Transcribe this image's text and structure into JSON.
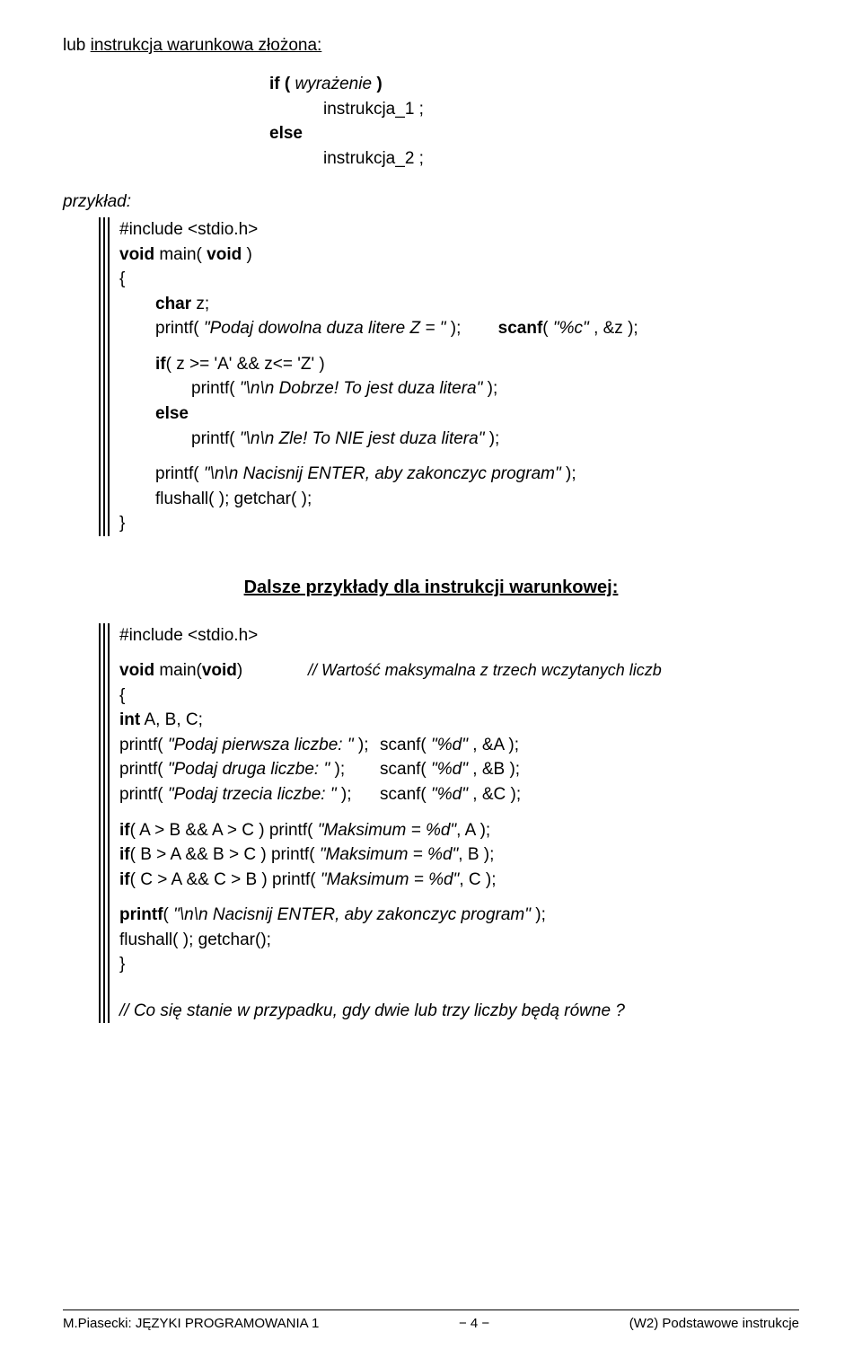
{
  "intro": {
    "prefix": "lub ",
    "underlined": "instrukcja warunkowa złożona:"
  },
  "syntax": {
    "line1a": "if ( ",
    "line1b": "wyrażenie",
    "line1c": " )",
    "line2": "instrukcja_1 ;",
    "line3": "else",
    "line4": "instrukcja_2 ;"
  },
  "example_label": "przykład:",
  "code1": {
    "l1": "#include <stdio.h>",
    "l2a": "void",
    "l2b": " main( ",
    "l2c": "void",
    "l2d": " )",
    "l3": "{",
    "l4a": "char",
    "l4b": " z;",
    "l5a": "printf( ",
    "l5b": "\"Podaj dowolna duza litere Z = \"",
    "l5c": " );",
    "l5d": "scanf",
    "l5e": "( ",
    "l5f": "\"%c\"",
    "l5g": " , &z );",
    "l6a": "if",
    "l6b": "( z >= 'A'  &&  z<= 'Z' )",
    "l7a": "printf( ",
    "l7b": "\"\\n\\n Dobrze! To jest duza litera\"",
    "l7c": " );",
    "l8": "else",
    "l9a": "printf( ",
    "l9b": "\"\\n\\n Zle! To NIE jest duza litera\"",
    "l9c": " );",
    "l10a": "printf( ",
    "l10b": "\"\\n\\n Nacisnij ENTER, aby zakonczyc program\"",
    "l10c": " );",
    "l11": "flushall( ); getchar( );",
    "l12": "}"
  },
  "section_heading": "Dalsze przykłady dla instrukcji warunkowej:",
  "code2": {
    "l1": "#include <stdio.h>",
    "l2a": "void",
    "l2b": " main(",
    "l2c": "void",
    "l2d": ")",
    "l2comment": "// Wartość maksymalna z trzech wczytanych liczb",
    "l3": "{",
    "l4a": "int",
    "l4b": " A, B, C;",
    "l5a": "printf( ",
    "l5i": "\"Podaj pierwsza liczbe: \"",
    "l5b": " );",
    "l5c": "scanf( ",
    "l5it": "\"%d\"",
    "l5d": " , &A );",
    "l6a": "printf( ",
    "l6i": "\"Podaj druga liczbe: \"",
    "l6b": " );",
    "l6c": "scanf( ",
    "l6d": " , &B );",
    "l7a": "printf( ",
    "l7i": "\"Podaj trzecia liczbe: \"",
    "l7b": " );",
    "l7c": "scanf( ",
    "l7d": " , &C );",
    "l8a": "if",
    "l8b": "( A > B  &&  A > C )  printf( ",
    "l8i": "\"Maksimum = %d\"",
    "l8c": ",  A );",
    "l9a": "if",
    "l9b": "( B > A  &&  B > C )  printf( ",
    "l9c": ",  B );",
    "l10a": "if",
    "l10b": "( C > A  &&  C > B )  printf( ",
    "l10c": ",  C );",
    "l11a": "printf",
    "l11b": "( ",
    "l11i": "\"\\n\\n Nacisnij ENTER, aby zakonczyc program\"",
    "l11c": " );",
    "l12": "flushall( ); getchar();",
    "l13": "}"
  },
  "bottom_comment": "// Co się stanie w przypadku, gdy dwie lub trzy liczby będą równe ?",
  "footer": {
    "left": "M.Piasecki: JĘZYKI PROGRAMOWANIA 1",
    "center": "− 4 −",
    "right": "(W2)  Podstawowe instrukcje"
  }
}
